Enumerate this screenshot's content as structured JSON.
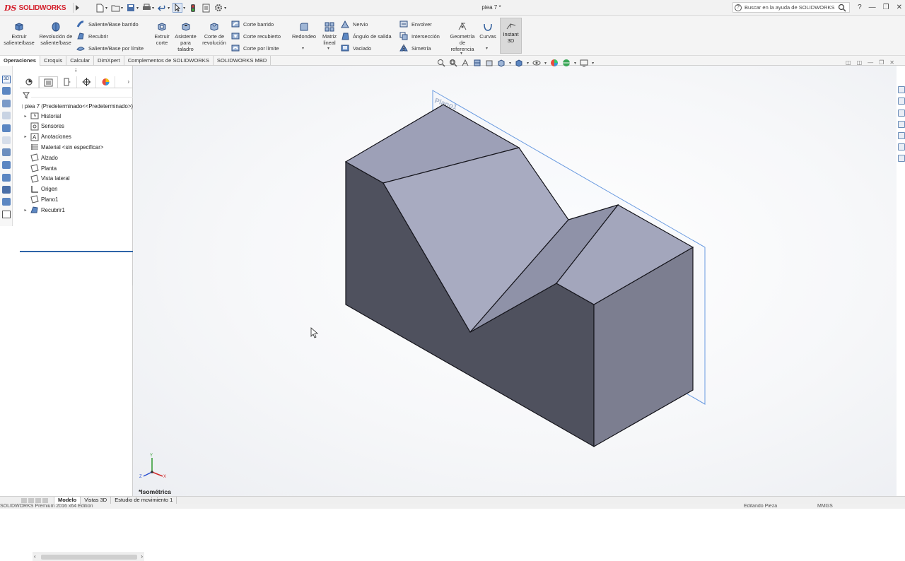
{
  "app": {
    "logo_ds": "DS",
    "logo_text": "SOLIDWORKS",
    "doc_title": "piea 7 *",
    "help_placeholder": "Buscar en la ayuda de SOLIDWORKS",
    "help_q": "?"
  },
  "quick_access": [
    "new-document-icon",
    "open-icon",
    "save-icon",
    "print-icon",
    "undo-icon",
    "select-icon",
    "rebuild-icon",
    "file-properties-icon",
    "options-icon"
  ],
  "window_controls": {
    "help": "?",
    "minimize": "—",
    "restore": "❐",
    "close": "✕"
  },
  "commands": {
    "extruir_saliente": "Extruir saliente/base",
    "revolucion_saliente": "Revolución de saliente/base",
    "saliente_barrido": "Saliente/Base barrido",
    "recubrir": "Recubrir",
    "saliente_limite": "Saliente/Base por límite",
    "extruir_corte": "Extruir corte",
    "asistente_taladro": "Asistente para taladro",
    "corte_revolucion": "Corte de revolución",
    "corte_barrido": "Corte barrido",
    "corte_recubierto": "Corte recubierto",
    "corte_limite": "Corte por límite",
    "redondeo": "Redondeo",
    "matriz_lineal": "Matriz lineal",
    "nervio": "Nervio",
    "angulo_salida": "Ángulo de salida",
    "vaciado": "Vaciado",
    "envolver": "Envolver",
    "interseccion": "Intersección",
    "simetria": "Simetría",
    "geometria_referencia": "Geometría de referencia",
    "curvas": "Curvas",
    "instant3d": "Instant 3D"
  },
  "tabs": [
    {
      "label": "Operaciones",
      "active": true
    },
    {
      "label": "Croquis",
      "active": false
    },
    {
      "label": "Calcular",
      "active": false
    },
    {
      "label": "DimXpert",
      "active": false
    },
    {
      "label": "Complementos de SOLIDWORKS",
      "active": false
    },
    {
      "label": "SOLIDWORKS MBD",
      "active": false
    }
  ],
  "tree": {
    "root": "piea 7  (Predeterminado<<Predeterminado>)",
    "items": [
      {
        "label": "Historial",
        "expand": "▸",
        "icon": "history-folder-icon"
      },
      {
        "label": "Sensores",
        "expand": "",
        "icon": "sensors-icon"
      },
      {
        "label": "Anotaciones",
        "expand": "▸",
        "icon": "annotations-icon"
      },
      {
        "label": "Material <sin especificar>",
        "expand": "",
        "icon": "material-icon"
      },
      {
        "label": "Alzado",
        "expand": "",
        "icon": "plane-icon"
      },
      {
        "label": "Planta",
        "expand": "",
        "icon": "plane-icon"
      },
      {
        "label": "Vista lateral",
        "expand": "",
        "icon": "plane-icon"
      },
      {
        "label": "Origen",
        "expand": "",
        "icon": "origin-icon"
      },
      {
        "label": "Plano1",
        "expand": "",
        "icon": "plane-icon"
      },
      {
        "label": "Recubrir1",
        "expand": "▸",
        "icon": "loft-feature-icon"
      }
    ]
  },
  "viewport": {
    "plane_label": "Plano1",
    "view_name": "*Isométrica",
    "triad_labels": {
      "x": "X",
      "y": "Y",
      "z": "Z"
    }
  },
  "bottom_tabs": [
    {
      "label": "Modelo",
      "active": true
    },
    {
      "label": "Vistas 3D",
      "active": false
    },
    {
      "label": "Estudio de movimiento 1",
      "active": false
    }
  ],
  "status": {
    "left": "SOLIDWORKS Premium 2016 x64 Edition",
    "mode": "Editando Pieza",
    "units": "MMGS"
  },
  "colors": {
    "brand": "#d4202c",
    "model_top": "#a9acc2",
    "model_front": "#4e505d",
    "model_right": "#7c7e90",
    "plane_outline": "#6a9be0"
  }
}
